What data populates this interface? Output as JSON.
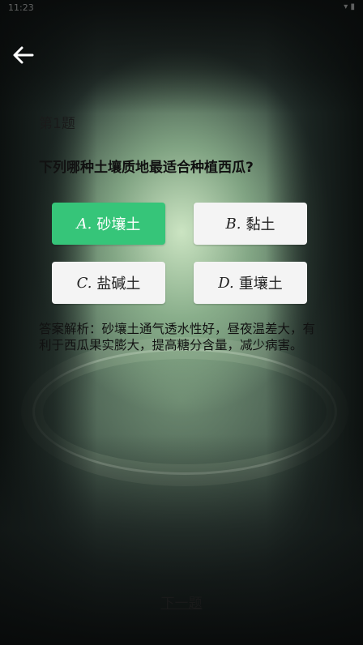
{
  "status_bar": {
    "time": "11:23",
    "icons_label": "▾ ▮"
  },
  "nav": {
    "back_icon": "arrow-left-icon"
  },
  "quiz": {
    "question_number": "第1题",
    "question": "下列哪种土壤质地最适合种植西瓜?",
    "options": [
      {
        "letter": "A.",
        "text": "砂壤土",
        "state": "correct"
      },
      {
        "letter": "B.",
        "text": "黏土",
        "state": "default"
      },
      {
        "letter": "C.",
        "text": "盐碱土",
        "state": "default"
      },
      {
        "letter": "D.",
        "text": "重壤土",
        "state": "default"
      }
    ],
    "analysis": "答案解析：砂壤土通气透水性好，昼夜温差大，有利于西瓜果实膨大，提高糖分含量，减少病害。",
    "next_label": "下一题"
  },
  "colors": {
    "correct": "#36c579",
    "option_default": "#f4f4f4",
    "text": "#111111"
  }
}
